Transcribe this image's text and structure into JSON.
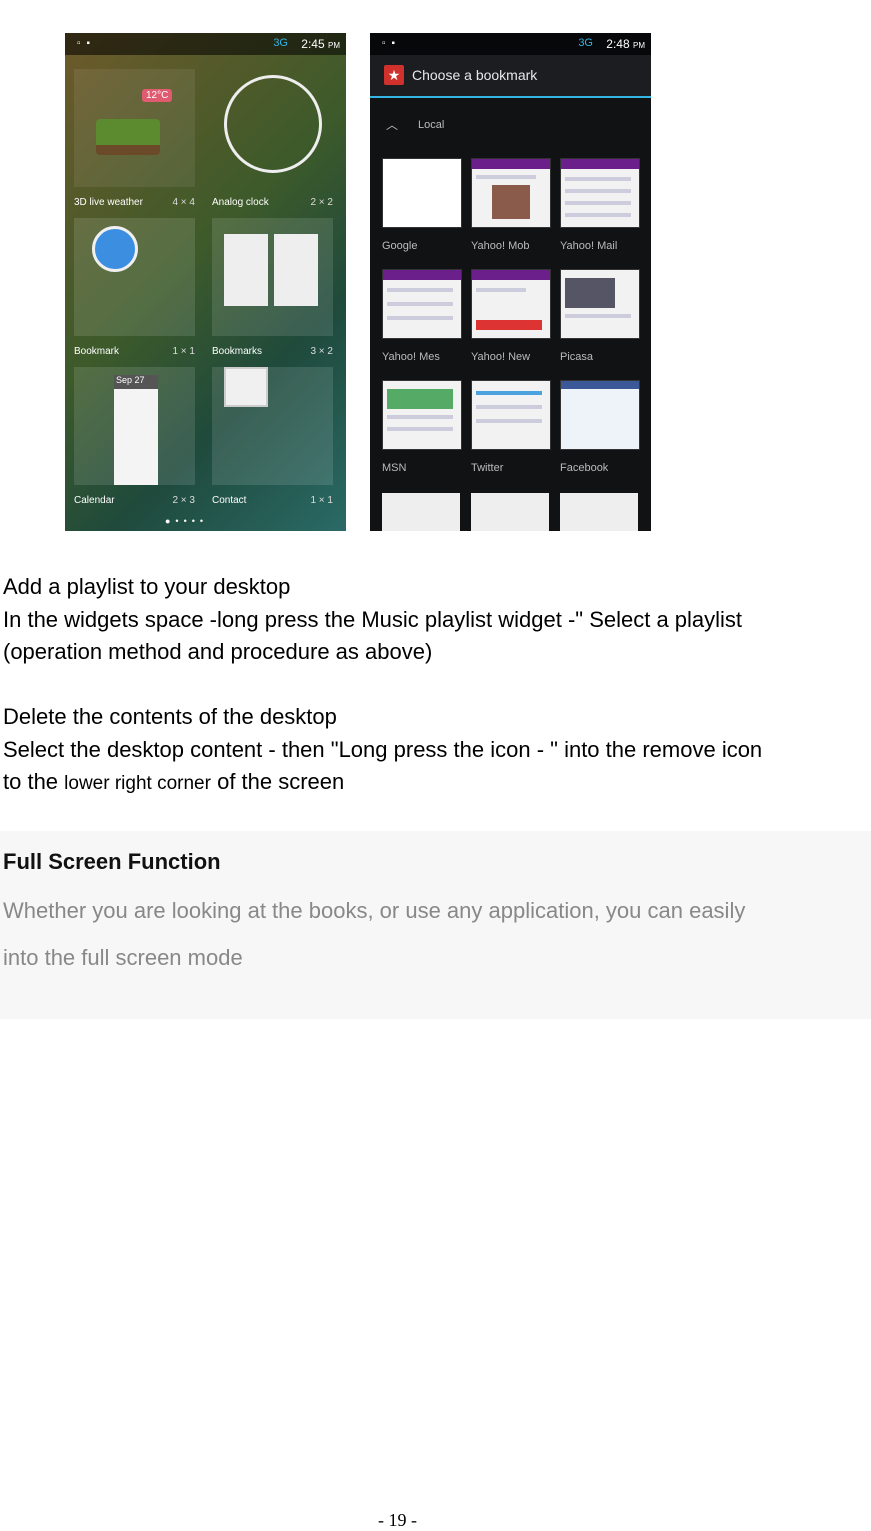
{
  "screenshot_left": {
    "status_time": "2:45",
    "status_ampm": "PM",
    "status_network": "3G",
    "widgets": [
      {
        "label": "3D live weather",
        "size": "4 × 4"
      },
      {
        "label": "Analog clock",
        "size": "2 × 2"
      },
      {
        "label": "Bookmark",
        "size": "1 × 1"
      },
      {
        "label": "Bookmarks",
        "size": "3 × 2"
      },
      {
        "label": "Calendar",
        "size": "2 × 3"
      },
      {
        "label": "Contact",
        "size": "1 × 1"
      }
    ],
    "weather_temp": "12°C",
    "calendar_date": "Sep 27"
  },
  "screenshot_right": {
    "status_time": "2:48",
    "status_ampm": "PM",
    "status_network": "3G",
    "title": "Choose a bookmark",
    "section": "Local",
    "bookmarks": [
      "Google",
      "Yahoo! Mob",
      "Yahoo! Mail",
      "Yahoo! Mes",
      "Yahoo! New",
      "Picasa",
      "MSN",
      "Twitter",
      "Facebook"
    ]
  },
  "section1": {
    "title": "Add a playlist to your desktop",
    "line1": "In the widgets space -long press the Music playlist widget -\" Select a playlist",
    "line2": "(operation method and procedure as above)"
  },
  "section2": {
    "title": "Delete the contents of the desktop",
    "line1": "Select the desktop content - then \"Long press the icon - \" into the remove icon",
    "line2_a": "to the",
    "line2_b": "lower right corner",
    "line2_c": "of the screen"
  },
  "fullscreen": {
    "title_a": "Full Screen",
    "title_b": "Function",
    "line1": "Whether you are looking at the books, or use any application, you can easily",
    "line2": "into the full screen mode"
  },
  "page_number": "- 19 -"
}
